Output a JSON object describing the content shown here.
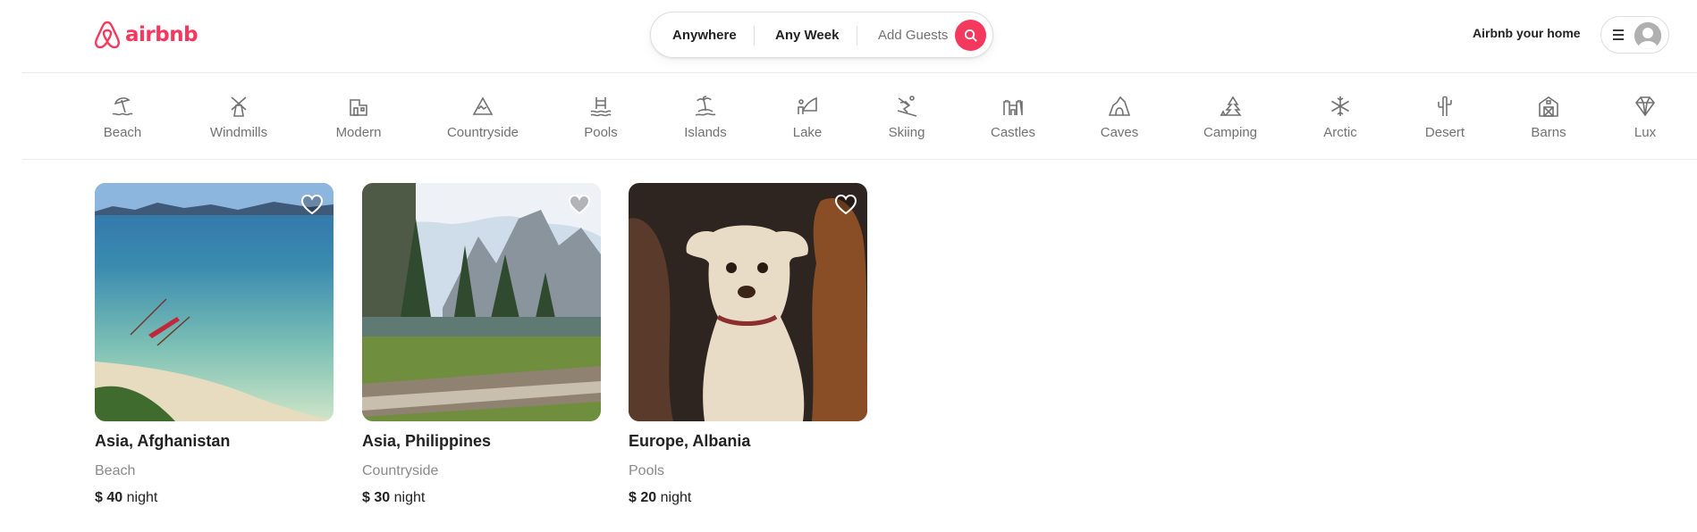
{
  "brand": {
    "name": "airbnb",
    "color": "#F5385D"
  },
  "search": {
    "location_label": "Anywhere",
    "week_label": "Any Week",
    "guests_label": "Add Guests",
    "button_icon": "search-icon"
  },
  "header": {
    "host_link": "Airbnb your home",
    "menu_icon": "hamburger-icon",
    "avatar_icon": "user-avatar-icon"
  },
  "categories": [
    {
      "label": "Beach",
      "icon": "beach-umbrella-icon"
    },
    {
      "label": "Windmills",
      "icon": "windmill-icon"
    },
    {
      "label": "Modern",
      "icon": "modern-house-icon"
    },
    {
      "label": "Countryside",
      "icon": "mountain-icon"
    },
    {
      "label": "Pools",
      "icon": "pool-icon"
    },
    {
      "label": "Islands",
      "icon": "island-icon"
    },
    {
      "label": "Lake",
      "icon": "lake-icon"
    },
    {
      "label": "Skiing",
      "icon": "skiing-icon"
    },
    {
      "label": "Castles",
      "icon": "castle-icon"
    },
    {
      "label": "Caves",
      "icon": "cave-icon"
    },
    {
      "label": "Camping",
      "icon": "camping-icon"
    },
    {
      "label": "Arctic",
      "icon": "snowflake-icon"
    },
    {
      "label": "Desert",
      "icon": "cactus-icon"
    },
    {
      "label": "Barns",
      "icon": "barn-icon"
    },
    {
      "label": "Lux",
      "icon": "diamond-icon"
    }
  ],
  "listings": [
    {
      "title": "Asia, Afghanistan",
      "category": "Beach",
      "currency": "$",
      "price": "40",
      "unit": "night",
      "image": "beach-lagoon-photo"
    },
    {
      "title": "Asia, Philippines",
      "category": "Countryside",
      "currency": "$",
      "price": "30",
      "unit": "night",
      "image": "valley-forest-photo"
    },
    {
      "title": "Europe, Albania",
      "category": "Pools",
      "currency": "$",
      "price": "20",
      "unit": "night",
      "image": "three-dogs-photo"
    }
  ]
}
